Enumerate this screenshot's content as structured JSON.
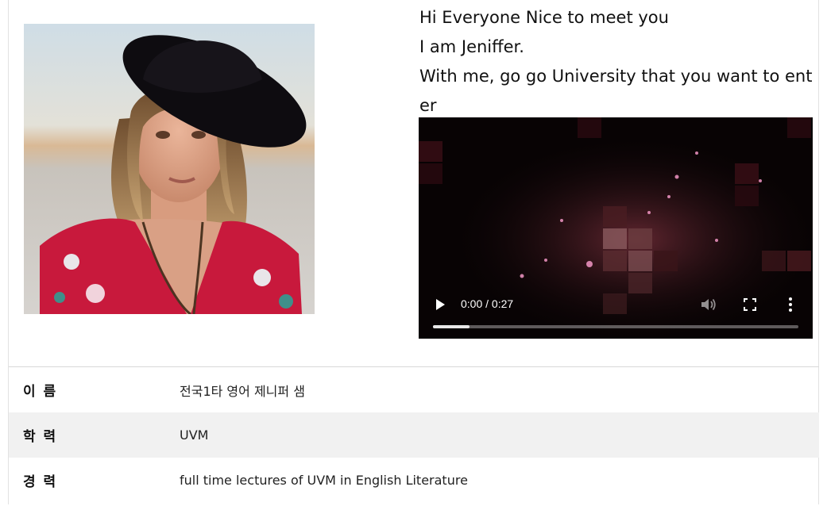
{
  "profile": {
    "photo_alt": "woman-in-black-hat",
    "intro_lines": [
      "Hi Everyone Nice to meet you",
      "I am Jeniffer.",
      "With me, go go University that you want to enter"
    ]
  },
  "video": {
    "time": "0:00 / 0:27",
    "progress_fraction": 0.1,
    "icons": [
      "play-icon",
      "volume-icon",
      "fullscreen-icon",
      "more-options-icon"
    ]
  },
  "info_table": {
    "rows": [
      {
        "label": "이 름",
        "value": "전국1타 영어 제니퍼 샘"
      },
      {
        "label": "학 력",
        "value": "UVM"
      },
      {
        "label": "경 력",
        "value": "full time lectures of UVM in English Literature"
      }
    ]
  },
  "colors": {
    "row_alt": "#f1f1f1",
    "border": "#d8d8d8",
    "hat": "#0e0c10",
    "dress": "#c8193c"
  }
}
